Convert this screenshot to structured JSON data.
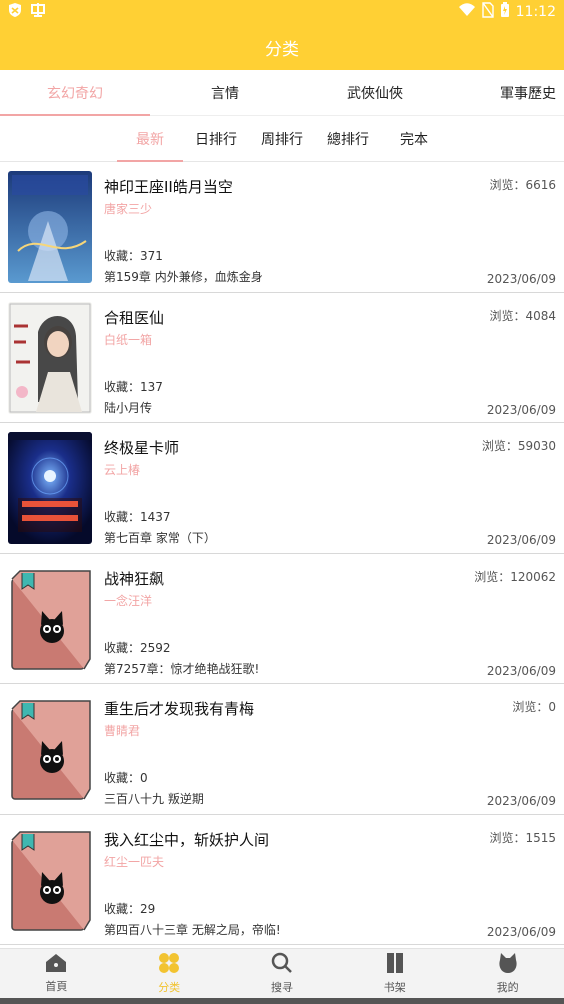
{
  "status_bar": {
    "time": "11:12"
  },
  "header": {
    "title": "分类"
  },
  "category_tabs": [
    {
      "label": "玄幻奇幻"
    },
    {
      "label": "言情"
    },
    {
      "label": "武俠仙俠"
    },
    {
      "label": "軍事歷史"
    }
  ],
  "sub_tabs": [
    {
      "label": "最新"
    },
    {
      "label": "日排行"
    },
    {
      "label": "周排行"
    },
    {
      "label": "總排行"
    },
    {
      "label": "完本"
    }
  ],
  "books": [
    {
      "title": "神印王座II皓月当空",
      "author": "唐家三少",
      "favorites": "收藏：371",
      "chapter": "第159章 内外兼修，血炼金身",
      "views": "浏览：6616",
      "date": "2023/06/09",
      "cover_icon": "cover-image"
    },
    {
      "title": "合租医仙",
      "author": "白纸一箱",
      "favorites": "收藏：137",
      "chapter": "陆小月传",
      "views": "浏览：4084",
      "date": "2023/06/09",
      "cover_icon": "cover-image"
    },
    {
      "title": "终极星卡师",
      "author": "云上椿",
      "favorites": "收藏：1437",
      "chapter": "第七百章 家常（下）",
      "views": "浏览：59030",
      "date": "2023/06/09",
      "cover_icon": "cover-image"
    },
    {
      "title": "战神狂飙",
      "author": "一念汪洋",
      "favorites": "收藏：2592",
      "chapter": "第7257章：惊才绝艳战狂歌!",
      "views": "浏览：120062",
      "date": "2023/06/09",
      "cover_icon": "placeholder-book-cat-icon"
    },
    {
      "title": "重生后才发现我有青梅",
      "author": "曹睛君",
      "favorites": "收藏：0",
      "chapter": "三百八十九 叛逆期",
      "views": "浏览：0",
      "date": "2023/06/09",
      "cover_icon": "placeholder-book-cat-icon"
    },
    {
      "title": "我入红尘中，斩妖护人间",
      "author": "红尘一匹夫",
      "favorites": "收藏：29",
      "chapter": "第四百八十三章 无解之局，帝临!",
      "views": "浏览：1515",
      "date": "2023/06/09",
      "cover_icon": "placeholder-book-cat-icon"
    }
  ],
  "bottom_nav": [
    {
      "label": "首頁",
      "icon": "home-icon"
    },
    {
      "label": "分类",
      "icon": "category-dots-icon"
    },
    {
      "label": "搜寻",
      "icon": "search-icon"
    },
    {
      "label": "书架",
      "icon": "bookshelf-icon"
    },
    {
      "label": "我的",
      "icon": "profile-cat-icon"
    }
  ],
  "colors": {
    "accent": "#ffd034",
    "pink": "#f2a5a5",
    "book_placeholder": "#c97a72"
  }
}
